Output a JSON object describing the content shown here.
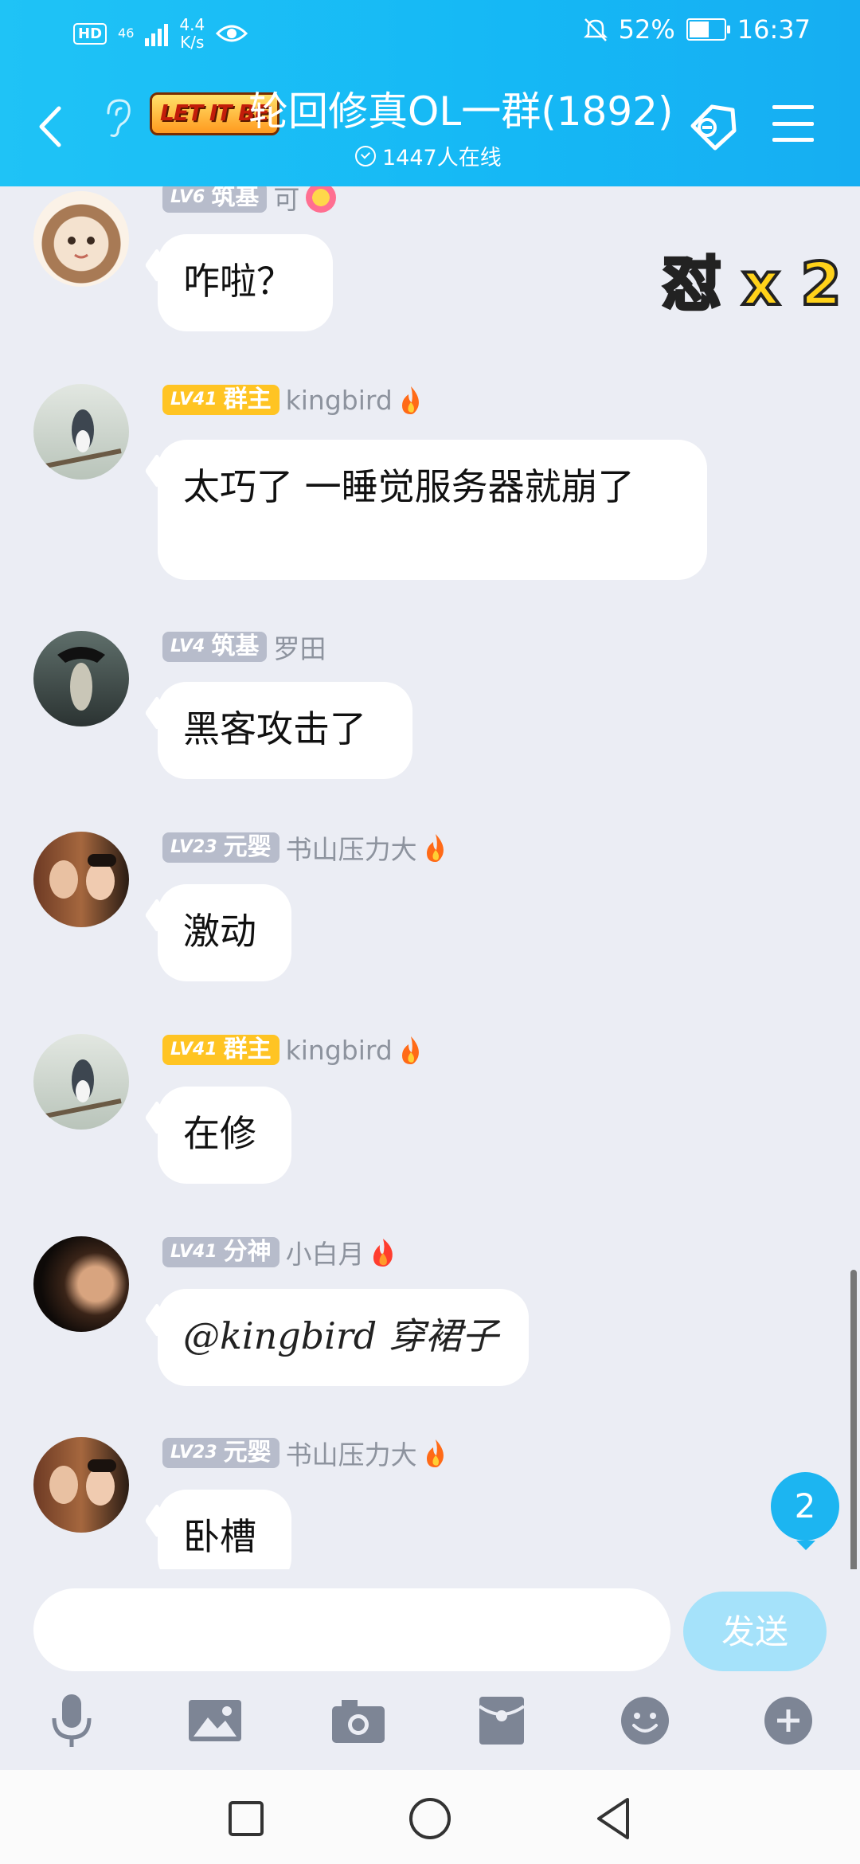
{
  "status_bar": {
    "hd": "HD",
    "network": "46",
    "speed_value": "4.4",
    "speed_unit": "K/s",
    "battery": "52%",
    "time": "16:37"
  },
  "header": {
    "logo_text": "LET IT BE",
    "title": "轮回修真OL一群(1892)",
    "online": "1447人在线"
  },
  "sticker_text": "怼 x 2",
  "messages": [
    {
      "level": "LV6",
      "rank": "筑基",
      "sender": "可",
      "text": "咋啦？"
    },
    {
      "level": "LV41",
      "rank": "群主",
      "sender": "kingbird",
      "text": "太巧了 一睡觉服务器就崩了"
    },
    {
      "level": "LV4",
      "rank": "筑基",
      "sender": "罗田",
      "text": "黑客攻击了"
    },
    {
      "level": "LV23",
      "rank": "元婴",
      "sender": "书山压力大",
      "text": "激动"
    },
    {
      "level": "LV41",
      "rank": "群主",
      "sender": "kingbird",
      "text": "在修"
    },
    {
      "level": "LV41",
      "rank": "分神",
      "sender": "小白月",
      "text": "@kingbird 穿裙子"
    },
    {
      "level": "LV23",
      "rank": "元婴",
      "sender": "书山压力大",
      "text": "卧槽"
    }
  ],
  "unread_count": "2",
  "input": {
    "placeholder": "",
    "send_label": "发送"
  },
  "colors": {
    "accent": "#16b8f5",
    "owner_badge": "#ffc423",
    "member_badge": "#b7bccb"
  }
}
